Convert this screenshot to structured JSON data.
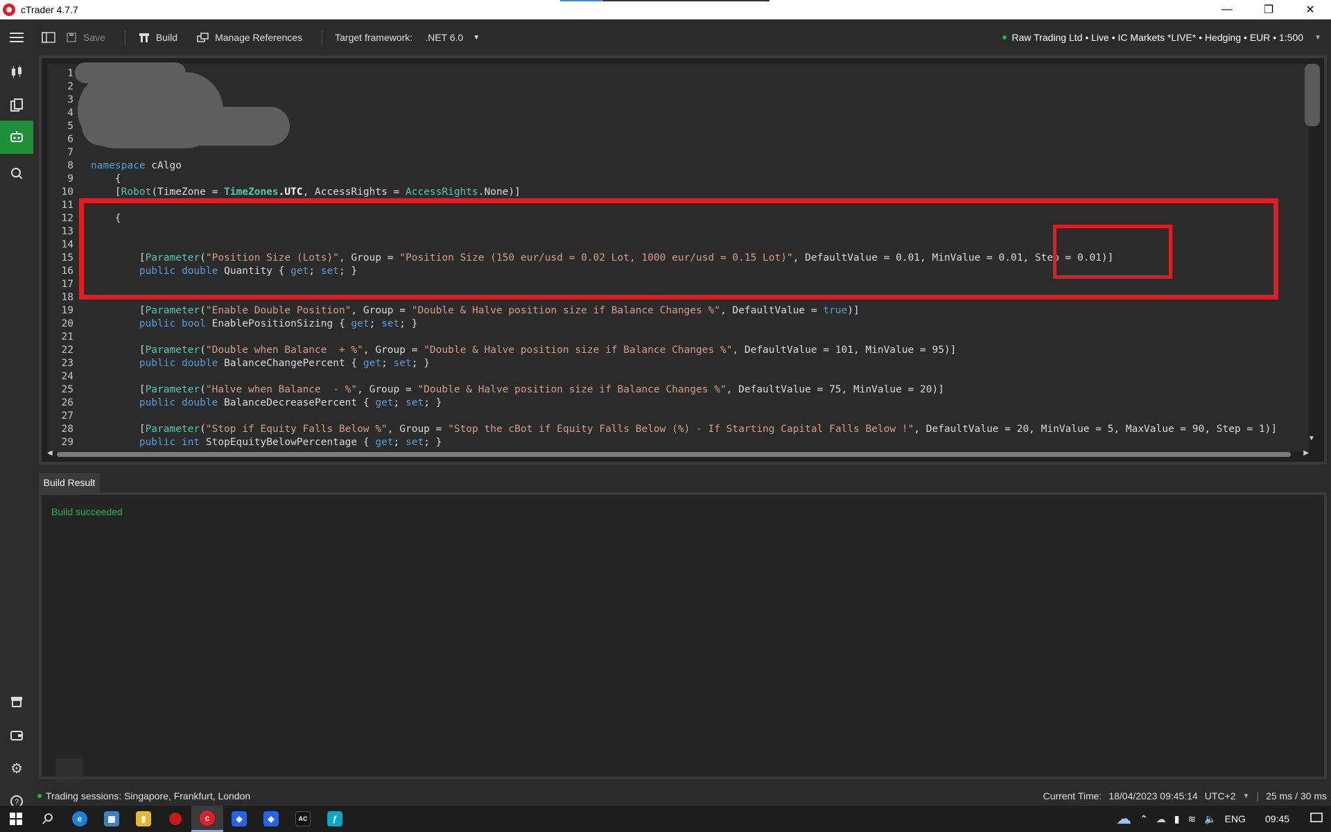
{
  "window": {
    "title": "cTrader 4.7.7"
  },
  "toolbar": {
    "save_label": "Save",
    "build_label": "Build",
    "manage_references_label": "Manage References",
    "target_framework_label": "Target framework:",
    "target_framework_value": ".NET 6.0",
    "account": "Raw Trading Ltd • Live • IC Markets *LIVE* • Hedging • EUR • 1:500"
  },
  "editor": {
    "lines": [
      {
        "n": "1"
      },
      {
        "n": "2"
      },
      {
        "n": "3"
      },
      {
        "n": "4"
      },
      {
        "n": "5"
      },
      {
        "n": "6"
      },
      {
        "n": "7"
      },
      {
        "n": "8",
        "parts": [
          {
            "t": "namespace",
            "c": "kw"
          },
          {
            "t": " cAlgo",
            "c": ""
          }
        ]
      },
      {
        "n": "9",
        "parts": [
          {
            "t": "    {",
            "c": ""
          }
        ]
      },
      {
        "n": "10",
        "parts": [
          {
            "t": "    [",
            "c": ""
          },
          {
            "t": "Robot",
            "c": "ty"
          },
          {
            "t": "(TimeZone = ",
            "c": ""
          },
          {
            "t": "TimeZones",
            "c": "tyb"
          },
          {
            "t": ".UTC",
            "c": "tyb2"
          },
          {
            "t": ", AccessRights = ",
            "c": ""
          },
          {
            "t": "AccessRights",
            "c": "ty"
          },
          {
            "t": ".None)]",
            "c": ""
          }
        ]
      },
      {
        "n": "11"
      },
      {
        "n": "12",
        "parts": [
          {
            "t": "    {",
            "c": ""
          }
        ]
      },
      {
        "n": "13"
      },
      {
        "n": "14"
      },
      {
        "n": "15",
        "parts": [
          {
            "t": "        [",
            "c": ""
          },
          {
            "t": "Parameter",
            "c": "ty"
          },
          {
            "t": "(",
            "c": ""
          },
          {
            "t": "\"Position Size (Lots)\"",
            "c": "str"
          },
          {
            "t": ", Group = ",
            "c": ""
          },
          {
            "t": "\"Position Size (150 eur/usd = 0.02 Lot, 1000 eur/usd = 0.15 Lot)\"",
            "c": "str"
          },
          {
            "t": ", DefaultValue = 0.01, MinValue = 0.01, Step = 0.01)]",
            "c": ""
          }
        ]
      },
      {
        "n": "16",
        "parts": [
          {
            "t": "        ",
            "c": ""
          },
          {
            "t": "public",
            "c": "kw"
          },
          {
            "t": " ",
            "c": ""
          },
          {
            "t": "double",
            "c": "kw"
          },
          {
            "t": " Quantity { ",
            "c": ""
          },
          {
            "t": "get",
            "c": "kw"
          },
          {
            "t": "; ",
            "c": ""
          },
          {
            "t": "set",
            "c": "kw"
          },
          {
            "t": "; }",
            "c": ""
          }
        ]
      },
      {
        "n": "17"
      },
      {
        "n": "18"
      },
      {
        "n": "19",
        "parts": [
          {
            "t": "        [",
            "c": ""
          },
          {
            "t": "Parameter",
            "c": "ty"
          },
          {
            "t": "(",
            "c": ""
          },
          {
            "t": "\"Enable Double Position\"",
            "c": "str"
          },
          {
            "t": ", Group = ",
            "c": ""
          },
          {
            "t": "\"Double & Halve position size if Balance Changes %\"",
            "c": "str"
          },
          {
            "t": ", DefaultValue = ",
            "c": ""
          },
          {
            "t": "true",
            "c": "kw"
          },
          {
            "t": ")]",
            "c": ""
          }
        ]
      },
      {
        "n": "20",
        "parts": [
          {
            "t": "        ",
            "c": ""
          },
          {
            "t": "public",
            "c": "kw"
          },
          {
            "t": " ",
            "c": ""
          },
          {
            "t": "bool",
            "c": "kw"
          },
          {
            "t": " EnablePositionSizing { ",
            "c": ""
          },
          {
            "t": "get",
            "c": "kw"
          },
          {
            "t": "; ",
            "c": ""
          },
          {
            "t": "set",
            "c": "kw"
          },
          {
            "t": "; }",
            "c": ""
          }
        ]
      },
      {
        "n": "21"
      },
      {
        "n": "22",
        "parts": [
          {
            "t": "        [",
            "c": ""
          },
          {
            "t": "Parameter",
            "c": "ty"
          },
          {
            "t": "(",
            "c": ""
          },
          {
            "t": "\"Double when Balance  + %\"",
            "c": "str"
          },
          {
            "t": ", Group = ",
            "c": ""
          },
          {
            "t": "\"Double & Halve position size if Balance Changes %\"",
            "c": "str"
          },
          {
            "t": ", DefaultValue = 101, MinValue = 95)]",
            "c": ""
          }
        ]
      },
      {
        "n": "23",
        "parts": [
          {
            "t": "        ",
            "c": ""
          },
          {
            "t": "public",
            "c": "kw"
          },
          {
            "t": " ",
            "c": ""
          },
          {
            "t": "double",
            "c": "kw"
          },
          {
            "t": " BalanceChangePercent { ",
            "c": ""
          },
          {
            "t": "get",
            "c": "kw"
          },
          {
            "t": "; ",
            "c": ""
          },
          {
            "t": "set",
            "c": "kw"
          },
          {
            "t": "; }",
            "c": ""
          }
        ]
      },
      {
        "n": "24"
      },
      {
        "n": "25",
        "parts": [
          {
            "t": "        [",
            "c": ""
          },
          {
            "t": "Parameter",
            "c": "ty"
          },
          {
            "t": "(",
            "c": ""
          },
          {
            "t": "\"Halve when Balance  - %\"",
            "c": "str"
          },
          {
            "t": ", Group = ",
            "c": ""
          },
          {
            "t": "\"Double & Halve position size if Balance Changes %\"",
            "c": "str"
          },
          {
            "t": ", DefaultValue = 75, MinValue = 20)]",
            "c": ""
          }
        ]
      },
      {
        "n": "26",
        "parts": [
          {
            "t": "        ",
            "c": ""
          },
          {
            "t": "public",
            "c": "kw"
          },
          {
            "t": " ",
            "c": ""
          },
          {
            "t": "double",
            "c": "kw"
          },
          {
            "t": " BalanceDecreasePercent { ",
            "c": ""
          },
          {
            "t": "get",
            "c": "kw"
          },
          {
            "t": "; ",
            "c": ""
          },
          {
            "t": "set",
            "c": "kw"
          },
          {
            "t": "; }",
            "c": ""
          }
        ]
      },
      {
        "n": "27"
      },
      {
        "n": "28",
        "parts": [
          {
            "t": "        [",
            "c": ""
          },
          {
            "t": "Parameter",
            "c": "ty"
          },
          {
            "t": "(",
            "c": ""
          },
          {
            "t": "\"Stop if Equity Falls Below %\"",
            "c": "str"
          },
          {
            "t": ", Group = ",
            "c": ""
          },
          {
            "t": "\"Stop the cBot if Equity Falls Below (%) - If Starting Capital Falls Below !\"",
            "c": "str"
          },
          {
            "t": ", DefaultValue = 20, MinValue = 5, MaxValue = 90, Step = 1)]",
            "c": ""
          }
        ]
      },
      {
        "n": "29",
        "parts": [
          {
            "t": "        ",
            "c": ""
          },
          {
            "t": "public",
            "c": "kw"
          },
          {
            "t": " ",
            "c": ""
          },
          {
            "t": "int",
            "c": "kw"
          },
          {
            "t": " StopEquityBelowPercentage { ",
            "c": ""
          },
          {
            "t": "get",
            "c": "kw"
          },
          {
            "t": "; ",
            "c": ""
          },
          {
            "t": "set",
            "c": "kw"
          },
          {
            "t": "; }",
            "c": ""
          }
        ]
      }
    ]
  },
  "build": {
    "tab_label": "Build Result",
    "message": "Build succeeded"
  },
  "status": {
    "sessions": "Trading sessions: Singapore, Frankfurt, London",
    "current_time_label": "Current Time:",
    "current_time": "18/04/2023 09:45:14",
    "timezone": "UTC+2",
    "latency": "25 ms / 30 ms"
  },
  "taskbar": {
    "language": "ENG",
    "clock": "09:45"
  },
  "colors": {
    "accent_green": "#1f8f3a",
    "success": "#21b24b",
    "highlight_red": "#e31b23"
  }
}
